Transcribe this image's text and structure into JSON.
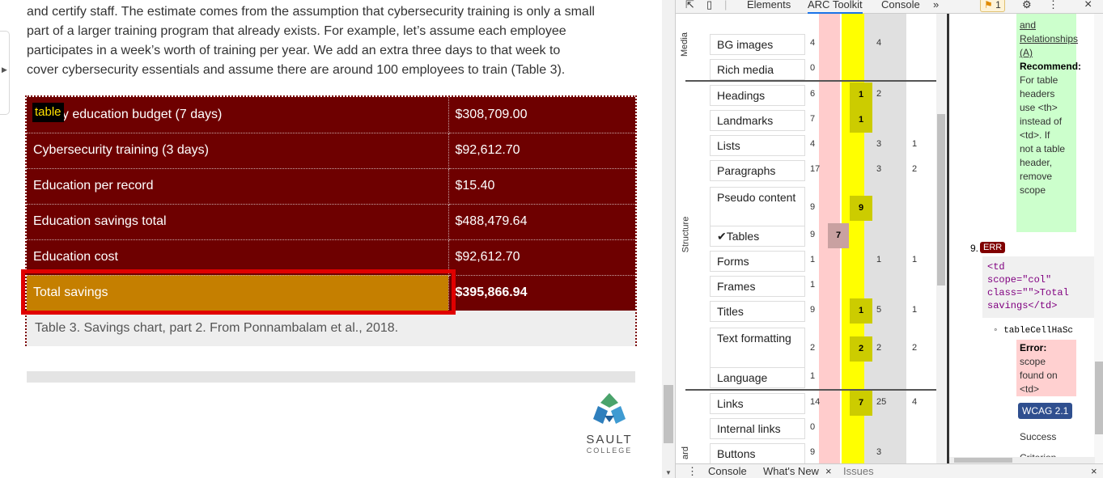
{
  "page": {
    "intro_lines": [
      "and certify staff. The estimate comes from the assumption that cybersecurity training is only a small",
      "part of a larger training program that already exists. For example, let’s assume each employee",
      "participates in a week’s worth of training per year. We add an extra three days to that week to",
      "cover cybersecurity essentials and assume there are around 100 employees to train (Table 3)."
    ],
    "table_tag": "table",
    "rows": [
      {
        "label": "Yearly education budget (7 days)",
        "value": "$308,709.00"
      },
      {
        "label": "Cybersecurity training (3 days)",
        "value": "$92,612.70"
      },
      {
        "label": "Education per record",
        "value": "$15.40"
      },
      {
        "label": "Education savings total",
        "value": "$488,479.64"
      },
      {
        "label": "Education cost",
        "value": "$92,612.70"
      },
      {
        "label": "Total savings",
        "value": "$395,866.94"
      }
    ],
    "caption": "Table 3. Savings chart, part 2. From Ponnambalam et al., 2018.",
    "logo": {
      "name": "SAULT",
      "sub": "COLLEGE"
    },
    "colors": {
      "table_bg": "#6e0000",
      "total_bg": "#c57f00",
      "highlight": "#e00000"
    }
  },
  "devtools": {
    "tabs": [
      "Elements",
      "ARC Toolkit",
      "Console"
    ],
    "active_tab": "ARC Toolkit",
    "more": "»",
    "issues_count": "1",
    "groups": {
      "media": "Media",
      "structure": "Structure",
      "bottom": "ard"
    },
    "categories": [
      {
        "label": "BG images",
        "c0": "4",
        "c1": "",
        "c2": "",
        "c3": "4",
        "c4": ""
      },
      {
        "label": "Rich media",
        "c0": "0",
        "c1": "",
        "c2": "",
        "c3": "",
        "c4": ""
      },
      {
        "label": "Headings",
        "c0": "6",
        "c1": "",
        "c2": "1",
        "c3": "2",
        "c4": ""
      },
      {
        "label": "Landmarks",
        "c0": "7",
        "c1": "",
        "c2": "1",
        "c3": "",
        "c4": ""
      },
      {
        "label": "Lists",
        "c0": "4",
        "c1": "",
        "c2": "",
        "c3": "3",
        "c4": "1"
      },
      {
        "label": "Paragraphs",
        "c0": "17",
        "c1": "",
        "c2": "",
        "c3": "3",
        "c4": "2"
      },
      {
        "label": "Pseudo content",
        "c0": "9",
        "c1": "",
        "c2": "9",
        "c3": "",
        "c4": ""
      },
      {
        "label": "✔Tables",
        "c0": "9",
        "c1": "7",
        "c2": "",
        "c3": "",
        "c4": ""
      },
      {
        "label": "Forms",
        "c0": "1",
        "c1": "",
        "c2": "",
        "c3": "1",
        "c4": "1"
      },
      {
        "label": "Frames",
        "c0": "1",
        "c1": "",
        "c2": "",
        "c3": "",
        "c4": ""
      },
      {
        "label": "Titles",
        "c0": "9",
        "c1": "",
        "c2": "1",
        "c3": "5",
        "c4": "1"
      },
      {
        "label": "Text formatting",
        "c0": "2",
        "c1": "",
        "c2": "2",
        "c3": "2",
        "c4": "2"
      },
      {
        "label": "Language",
        "c0": "1",
        "c1": "",
        "c2": "",
        "c3": "",
        "c4": ""
      },
      {
        "label": "Links",
        "c0": "14",
        "c1": "",
        "c2": "7",
        "c3": "25",
        "c4": "4"
      },
      {
        "label": "Internal links",
        "c0": "0",
        "c1": "",
        "c2": "",
        "c3": "",
        "c4": ""
      },
      {
        "label": "Buttons",
        "c0": "9",
        "c1": "",
        "c2": "",
        "c3": "3",
        "c4": ""
      }
    ],
    "detail": {
      "link_lines": [
        "and",
        "Relationships",
        "(A)"
      ],
      "recommend_title": "Recommend:",
      "recommend_lines": [
        "For table",
        "headers",
        "use <th>",
        "instead of",
        "<td>. If",
        "not a table",
        "header,",
        "remove",
        "scope"
      ],
      "item_number": "9.",
      "err_badge": "ERR",
      "code_lines": [
        "<td",
        "scope=\"col\"",
        "class=\"\">Total",
        "savings</td>"
      ],
      "bullet": "◦ tableCellHaSc",
      "error_title": "Error:",
      "error_lines": [
        "scope",
        "found on",
        "<td>"
      ],
      "wcag": "WCAG 2.1",
      "success_lines": [
        "Success",
        "Criterion"
      ]
    },
    "drawer": {
      "console": "Console",
      "whats_new": "What's New",
      "close_tab": "×",
      "issues": "Issues",
      "close": "×"
    }
  }
}
